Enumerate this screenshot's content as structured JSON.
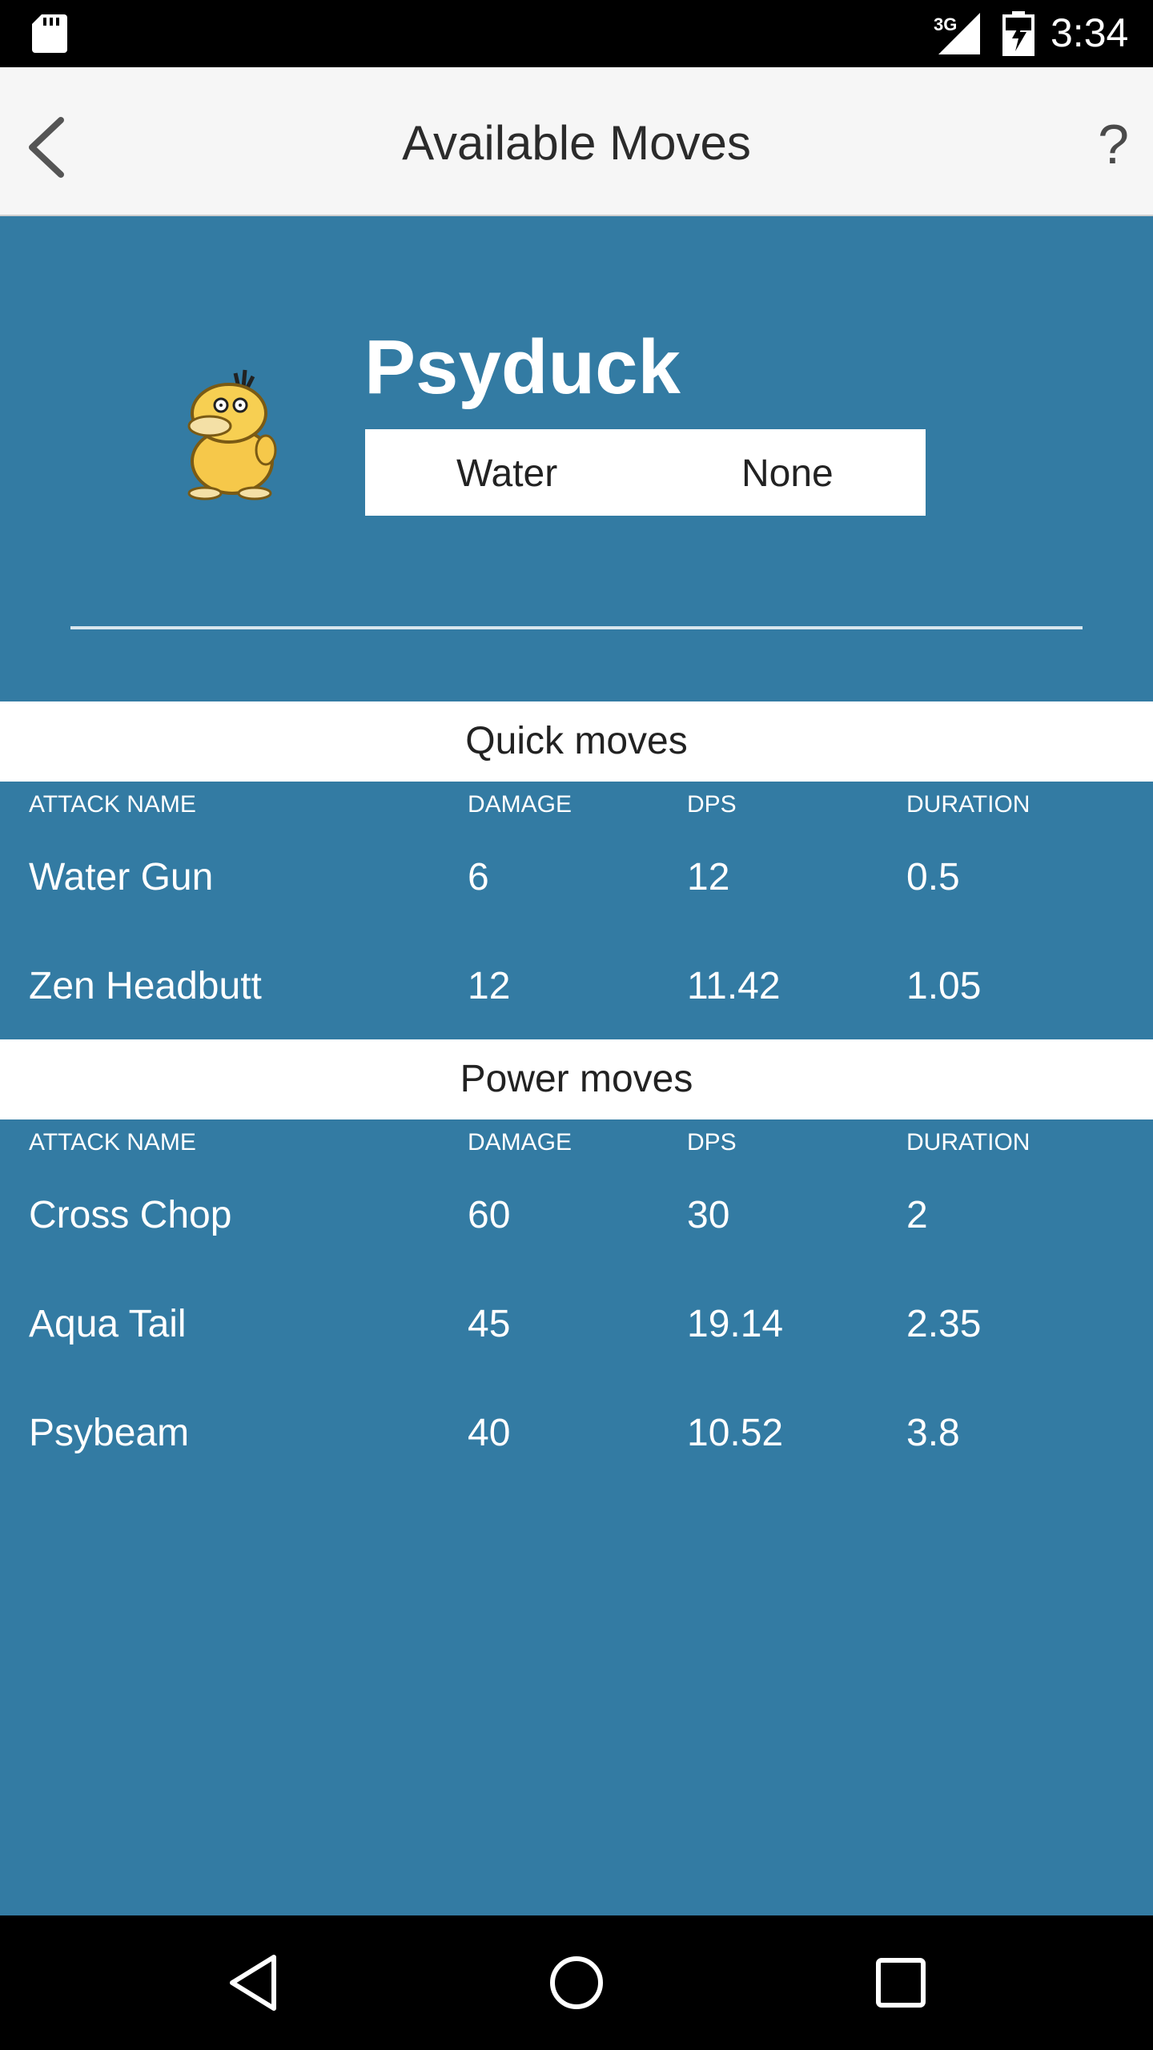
{
  "status_bar": {
    "network": "3G",
    "time": "3:34"
  },
  "app_bar": {
    "title": "Available Moves",
    "help": "?"
  },
  "pokemon": {
    "name": "Psyduck",
    "type1": "Water",
    "type2": "None"
  },
  "columns": [
    "ATTACK NAME",
    "DAMAGE",
    "DPS",
    "DURATION"
  ],
  "quick_moves": {
    "title": "Quick moves",
    "rows": [
      [
        "Water Gun",
        "6",
        "12",
        "0.5"
      ],
      [
        "Zen Headbutt",
        "12",
        "11.42",
        "1.05"
      ]
    ]
  },
  "power_moves": {
    "title": "Power moves",
    "rows": [
      [
        "Cross Chop",
        "60",
        "30",
        "2"
      ],
      [
        "Aqua Tail",
        "45",
        "19.14",
        "2.35"
      ],
      [
        "Psybeam",
        "40",
        "10.52",
        "3.8"
      ]
    ]
  },
  "colors": {
    "background": "#337ba3",
    "app_bar": "#f6f6f6",
    "section_header": "#ffffff"
  }
}
